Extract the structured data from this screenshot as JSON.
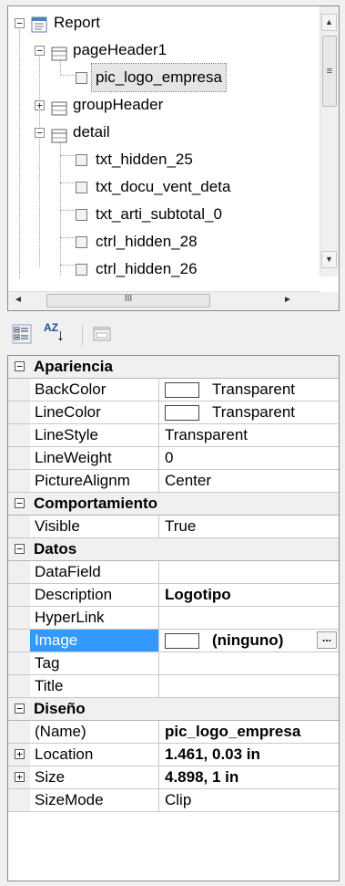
{
  "tree": {
    "items": [
      {
        "label": "Report",
        "expander": "−",
        "icon": "report-icon"
      },
      {
        "label": "pageHeader1",
        "expander": "−",
        "icon": "section-icon"
      },
      {
        "label": "pic_logo_empresa",
        "icon": "control-icon",
        "selected": true
      },
      {
        "label": "groupHeader",
        "expander": "+",
        "icon": "section-icon"
      },
      {
        "label": "detail",
        "expander": "−",
        "icon": "section-icon"
      },
      {
        "label": "txt_hidden_25",
        "icon": "control-icon"
      },
      {
        "label": "txt_docu_vent_deta",
        "icon": "control-icon"
      },
      {
        "label": "txt_arti_subtotal_0",
        "icon": "control-icon"
      },
      {
        "label": "ctrl_hidden_28",
        "icon": "control-icon"
      },
      {
        "label": "ctrl_hidden_26",
        "icon": "control-icon"
      }
    ],
    "scroll_up": "▲",
    "scroll_down": "▼",
    "scroll_left": "◄",
    "scroll_right": "►",
    "vthumb_grip": "≡",
    "hthumb_grip": "III"
  },
  "toolbar": {
    "categorized_icon": "categorized-icon",
    "alphabetical_label": "AZ",
    "alphabetical_arrow": "↓",
    "property_pages_icon": "property-pages-icon"
  },
  "grid": {
    "toggle_minus": "−",
    "toggle_plus": "+",
    "categories": [
      {
        "label": "Apariencia",
        "props": [
          {
            "name": "BackColor",
            "value": "Transparent",
            "swatch": "#ffffff"
          },
          {
            "name": "LineColor",
            "value": "Transparent",
            "swatch": "#ffffff"
          },
          {
            "name": "LineStyle",
            "value": "Transparent"
          },
          {
            "name": "LineWeight",
            "value": "0"
          },
          {
            "name": "PictureAlignm",
            "value": "Center"
          }
        ]
      },
      {
        "label": "Comportamiento",
        "props": [
          {
            "name": "Visible",
            "value": "True"
          }
        ]
      },
      {
        "label": "Datos",
        "props": [
          {
            "name": "DataField",
            "value": ""
          },
          {
            "name": "Description",
            "value": "Logotipo",
            "bold": true
          },
          {
            "name": "HyperLink",
            "value": ""
          },
          {
            "name": "Image",
            "value": "(ninguno)",
            "bold": true,
            "swatch": "#ffffff",
            "selected": true,
            "button": "..."
          },
          {
            "name": "Tag",
            "value": ""
          },
          {
            "name": "Title",
            "value": ""
          }
        ]
      },
      {
        "label": "Diseño",
        "props": [
          {
            "name": "(Name)",
            "value": "pic_logo_empresa",
            "bold": true
          },
          {
            "name": "Location",
            "value": "1.461, 0.03 in",
            "bold": true,
            "expandable": true
          },
          {
            "name": "Size",
            "value": "4.898, 1 in",
            "bold": true,
            "expandable": true
          },
          {
            "name": "SizeMode",
            "value": "Clip"
          }
        ]
      }
    ]
  },
  "colors": {
    "selection": "#3399ff",
    "category_bg": "#f0f0f0",
    "gridline": "#c8c8c8"
  }
}
